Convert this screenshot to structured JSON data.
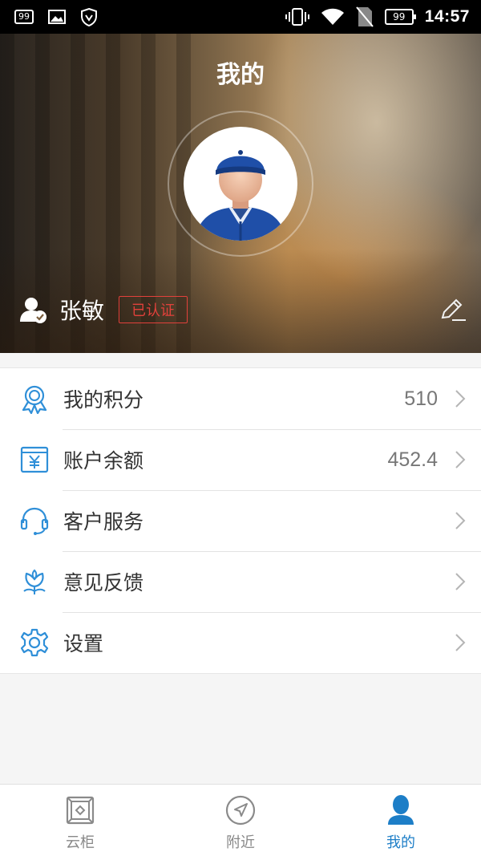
{
  "status_bar": {
    "notif_count": "99",
    "battery": "99",
    "time": "14:57"
  },
  "header": {
    "title": "我的",
    "user_name": "张敏",
    "verified_label": "已认证"
  },
  "menu": {
    "items": [
      {
        "label": "我的积分",
        "value": "510",
        "icon": "award-medal-icon"
      },
      {
        "label": "账户余额",
        "value": "452.4",
        "icon": "yuan-wallet-icon"
      },
      {
        "label": "客户服务",
        "value": "",
        "icon": "headset-icon"
      },
      {
        "label": "意见反馈",
        "value": "",
        "icon": "flower-feedback-icon"
      },
      {
        "label": "设置",
        "value": "",
        "icon": "gear-icon"
      }
    ]
  },
  "bottom_nav": {
    "items": [
      {
        "label": "云柜",
        "icon": "locker-box-icon",
        "active": false
      },
      {
        "label": "附近",
        "icon": "navigation-arrow-icon",
        "active": false
      },
      {
        "label": "我的",
        "icon": "person-icon",
        "active": true
      }
    ]
  },
  "colors": {
    "accent": "#1d7ec7",
    "icon_blue": "#2f8fd8",
    "verified_red": "#e2413b",
    "avatar_cap": "#1f4fa8"
  }
}
